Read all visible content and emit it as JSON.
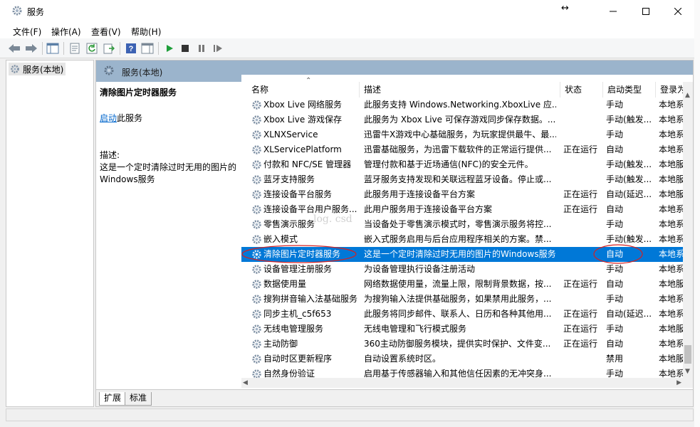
{
  "window": {
    "title": "服务",
    "resize_glyph": "↔"
  },
  "menu": [
    "文件(F)",
    "操作(A)",
    "查看(V)",
    "帮助(H)"
  ],
  "tree": {
    "root_label": "服务(本地)"
  },
  "content_header": {
    "title": "服务(本地)"
  },
  "detail": {
    "service_name": "清除图片定时器服务",
    "start_link": "启动",
    "start_suffix": "此服务",
    "desc_label": "描述:",
    "desc_text": "这是一个定时清除过时无用的图片的Windows服务"
  },
  "columns": {
    "name": "名称",
    "description": "描述",
    "status": "状态",
    "startup": "启动类型",
    "logon": "登录为"
  },
  "rows": [
    {
      "name": "Xbox Live 网络服务",
      "desc": "此服务支持 Windows.Networking.XboxLive 应...",
      "status": "",
      "startup": "手动",
      "logon": "本地系"
    },
    {
      "name": "Xbox Live 游戏保存",
      "desc": "此服务为 Xbox Live 可保存游戏同步保存数据。...",
      "status": "",
      "startup": "手动(触发...",
      "logon": "本地系"
    },
    {
      "name": "XLNXService",
      "desc": "迅雷牛X游戏中心基础服务，为玩家提供最牛、最...",
      "status": "",
      "startup": "手动",
      "logon": "本地系"
    },
    {
      "name": "XLServicePlatform",
      "desc": "迅雷基础服务，为迅雷下载软件的正常运行提供...",
      "status": "正在运行",
      "startup": "自动",
      "logon": "本地系"
    },
    {
      "name": "付款和 NFC/SE 管理器",
      "desc": "管理付款和基于近场通信(NFC)的安全元件。",
      "status": "",
      "startup": "手动(触发...",
      "logon": "本地服"
    },
    {
      "name": "蓝牙支持服务",
      "desc": "蓝牙服务支持发现和关联远程蓝牙设备。停止或...",
      "status": "",
      "startup": "手动(触发...",
      "logon": "本地服"
    },
    {
      "name": "连接设备平台服务",
      "desc": "此服务用于连接设备平台方案",
      "status": "正在运行",
      "startup": "自动(延迟...",
      "logon": "本地服"
    },
    {
      "name": "连接设备平台用户服务...",
      "desc": "此用户服务用于连接设备平台方案",
      "status": "正在运行",
      "startup": "自动",
      "logon": "本地系"
    },
    {
      "name": "零售演示服务",
      "desc": "当设备处于零售演示模式时，零售演示服务将控...",
      "status": "",
      "startup": "手动",
      "logon": "本地系"
    },
    {
      "name": "嵌入模式",
      "desc": "嵌入式服务启用与后台应用程序相关的方案。禁...",
      "status": "",
      "startup": "手动(触发...",
      "logon": "本地系"
    },
    {
      "name": "清除图片定时器服务",
      "desc": "这是一个定时清除过时无用的图片的Windows服务",
      "status": "",
      "startup": "自动",
      "logon": "本地系",
      "selected": true
    },
    {
      "name": "设备管理注册服务",
      "desc": "为设备管理执行设备注册活动",
      "status": "",
      "startup": "手动",
      "logon": "本地系"
    },
    {
      "name": "数据使用量",
      "desc": "网络数据使用量，流量上限，限制背景数据，按...",
      "status": "正在运行",
      "startup": "自动",
      "logon": "本地服"
    },
    {
      "name": "搜狗拼音输入法基础服务",
      "desc": "为搜狗输入法提供基础服务，如果禁用此服务，...",
      "status": "",
      "startup": "手动",
      "logon": "本地系"
    },
    {
      "name": "同步主机_c5f653",
      "desc": "此服务将同步邮件、联系人、日历和各种其他用...",
      "status": "正在运行",
      "startup": "自动(延迟...",
      "logon": "本地系"
    },
    {
      "name": "无线电管理服务",
      "desc": "无线电管理和飞行模式服务",
      "status": "正在运行",
      "startup": "手动",
      "logon": "本地服"
    },
    {
      "name": "主动防御",
      "desc": "360主动防御服务模块，提供实时保护、文件变...",
      "status": "正在运行",
      "startup": "自动",
      "logon": "本地系"
    },
    {
      "name": "自动时区更新程序",
      "desc": "自动设置系统时区。",
      "status": "",
      "startup": "禁用",
      "logon": "本地服"
    },
    {
      "name": "自然身份验证",
      "desc": "启用基于传感器输入和其他信任因素的无冲突身...",
      "status": "",
      "startup": "手动",
      "logon": "本地系"
    }
  ],
  "tabs": [
    "扩展",
    "标准"
  ],
  "watermark": "log. csd",
  "colors": {
    "selection": "#0078d7",
    "header_band": "#9bb4cc",
    "annotation": "#d62020",
    "link": "#0066cc"
  }
}
